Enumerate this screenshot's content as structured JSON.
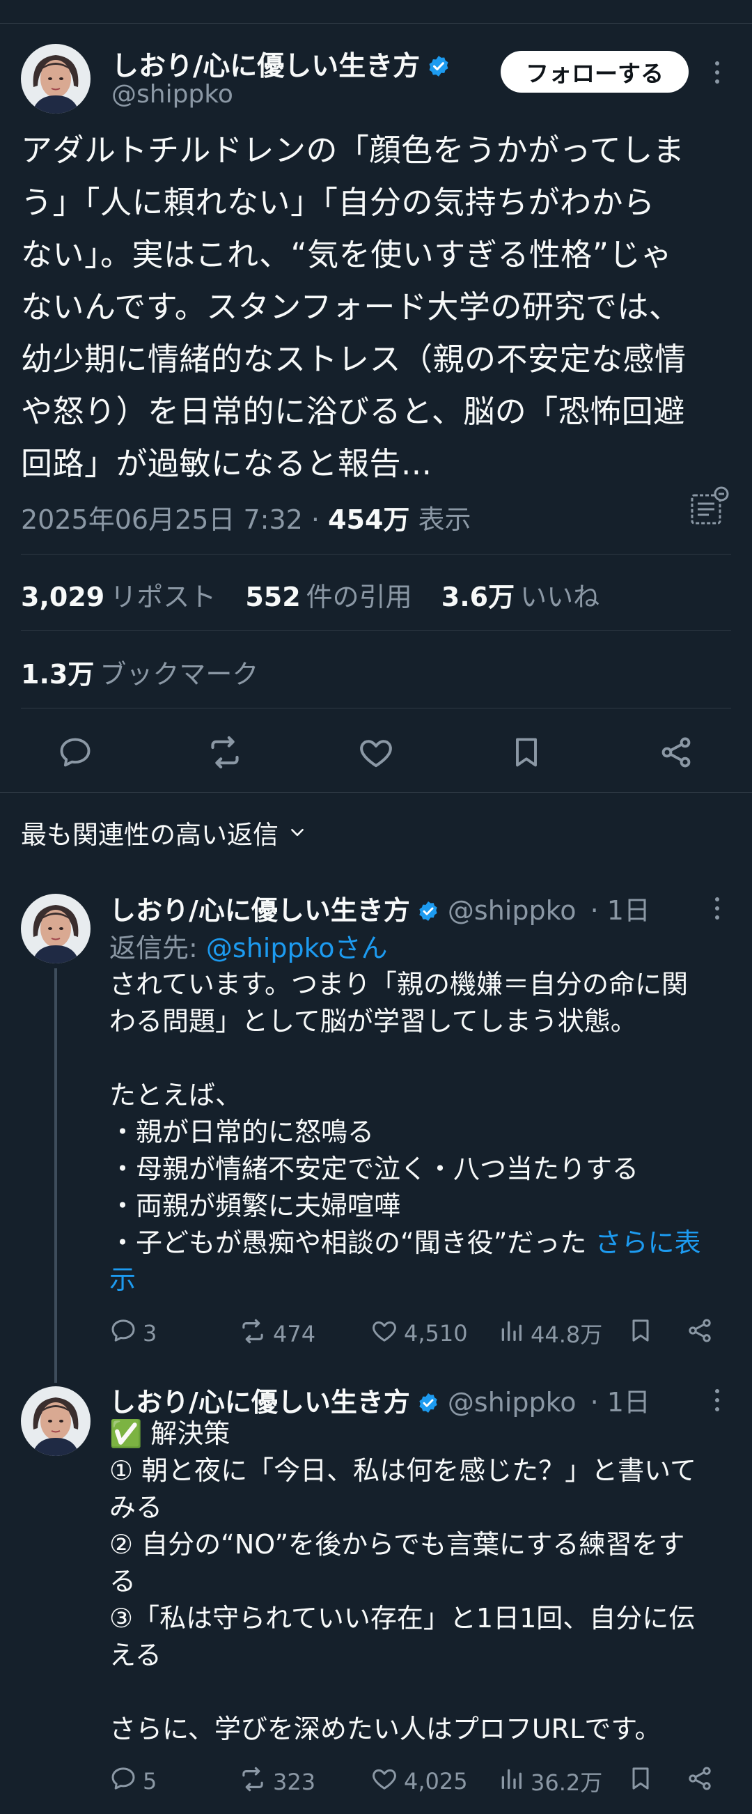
{
  "main_tweet": {
    "author_name": "しおり/心に優しい生き方",
    "handle": "@shippko",
    "follow_label": "フォローする",
    "text": "アダルトチルドレンの「顔色をうかがってしま\nう」「人に頼れない」「自分の気持ちがわから\nない」。実はこれ、“気を使いすぎる性格”じゃ\nないんです。スタンフォード大学の研究では、\n幼少期に情緒的なストレス（親の不安定な感情\nや怒り）を日常的に浴びると、脳の「恐怖回避\n回路」が過敏になると報告...",
    "datetime": "2025年06月25日 7:32",
    "views_count": "454万",
    "views_label": "表示",
    "reposts_count": "3,029",
    "reposts_label": "リポスト",
    "quotes_count": "552",
    "quotes_label": "件の引用",
    "likes_count": "3.6万",
    "likes_label": "いいね",
    "bookmarks_count": "1.3万",
    "bookmarks_label": "ブックマーク"
  },
  "replies_filter_label": "最も関連性の高い返信",
  "replies": [
    {
      "author_name": "しおり/心に優しい生き方",
      "handle": "@shippko",
      "age": "· 1日",
      "reply_to_label": "返信先: ",
      "reply_to_handle": "@shippkoさん",
      "text": "されています。つまり「親の機嫌＝自分の命に関\nわる問題」として脳が学習してしまう状態。\n\nたとえば、\n・親が日常的に怒鳴る\n・母親が情緒不安定で泣く・八つ当たりする\n・両親が頻繁に夫婦喧嘩\n・子どもが愚痴や相談の“聞き役”だった ",
      "show_more": "さらに表\n示",
      "replies": "3",
      "reposts": "474",
      "likes": "4,510",
      "views": "44.8万"
    },
    {
      "author_name": "しおり/心に優しい生き方",
      "handle": "@shippko",
      "age": "· 1日",
      "text": "✅ 解決策\n① 朝と夜に「今日、私は何を感じた？」と書いて\nみる\n② 自分の“NO”を後からでも言葉にする練習をす\nる\n③「私は守られていい存在」と1日1回、自分に伝\nえる\n\nさらに、学びを深めたい人はプロフURLです。",
      "replies": "5",
      "reposts": "323",
      "likes": "4,025",
      "views": "36.2万"
    }
  ],
  "icons": {
    "verified": "verified-badge-icon",
    "reply": "reply-icon",
    "repost": "repost-icon",
    "like": "heart-icon",
    "bookmark": "bookmark-icon",
    "share": "share-icon",
    "views": "views-icon"
  },
  "colors": {
    "background": "#15202b",
    "accent": "#1d9bf0",
    "secondary_text": "#8b98a5"
  }
}
